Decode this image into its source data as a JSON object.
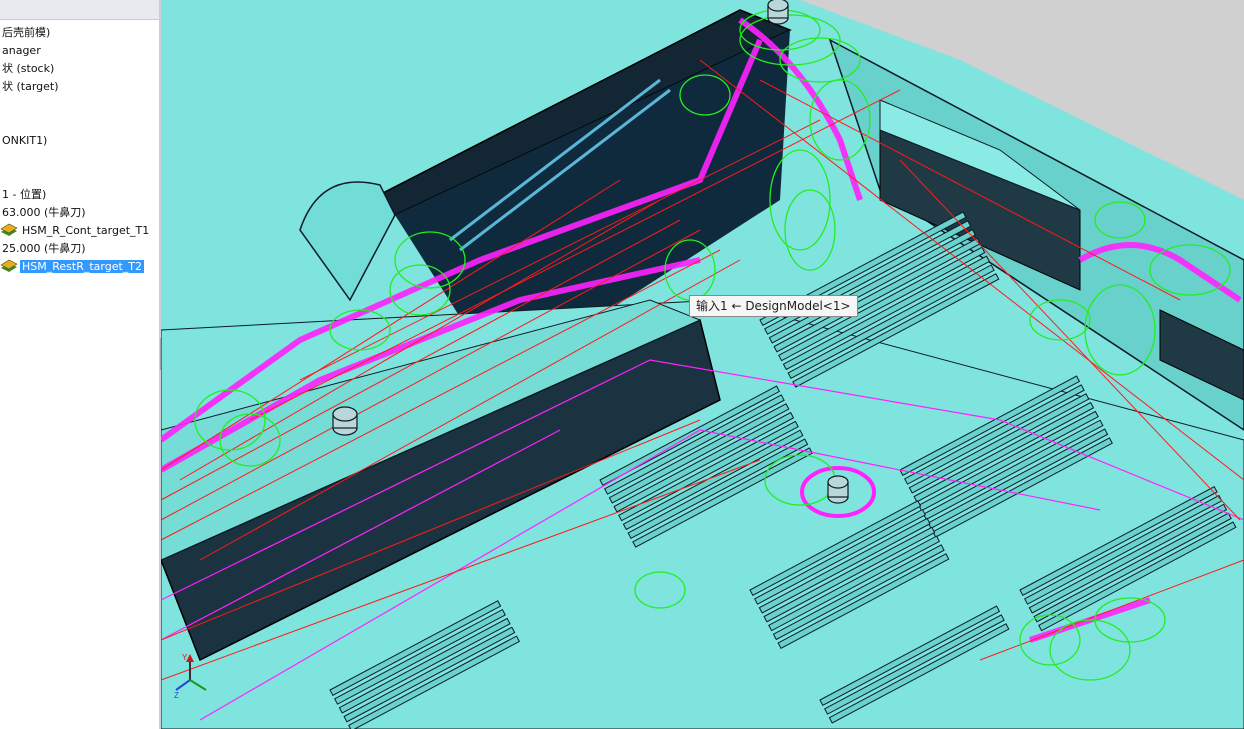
{
  "tree": {
    "items": [
      {
        "text": "后壳前模)"
      },
      {
        "text": "anager"
      },
      {
        "text": "状 (stock)"
      },
      {
        "text": "状 (target)"
      },
      {
        "text": "ONKIT1)"
      },
      {
        "text": "1 - 位置)"
      },
      {
        "text": "63.000 (牛鼻刀)"
      },
      {
        "text": "HSM_R_Cont_target_T1"
      },
      {
        "text": "25.000 (牛鼻刀)"
      },
      {
        "text": "HSM_RestR_target_T2"
      }
    ]
  },
  "viewport": {
    "tooltip": "输入1 ← DesignModel<1>",
    "colors": {
      "model": "#7fe3de",
      "edge": "#0d1b26",
      "toolpath_red": "#ff1a1a",
      "toolpath_green": "#22ee22",
      "toolpath_magenta": "#ff22ff"
    }
  },
  "icons": [
    "operation-icon",
    "collapse-arrow-icon",
    "axis-triad-icon"
  ]
}
